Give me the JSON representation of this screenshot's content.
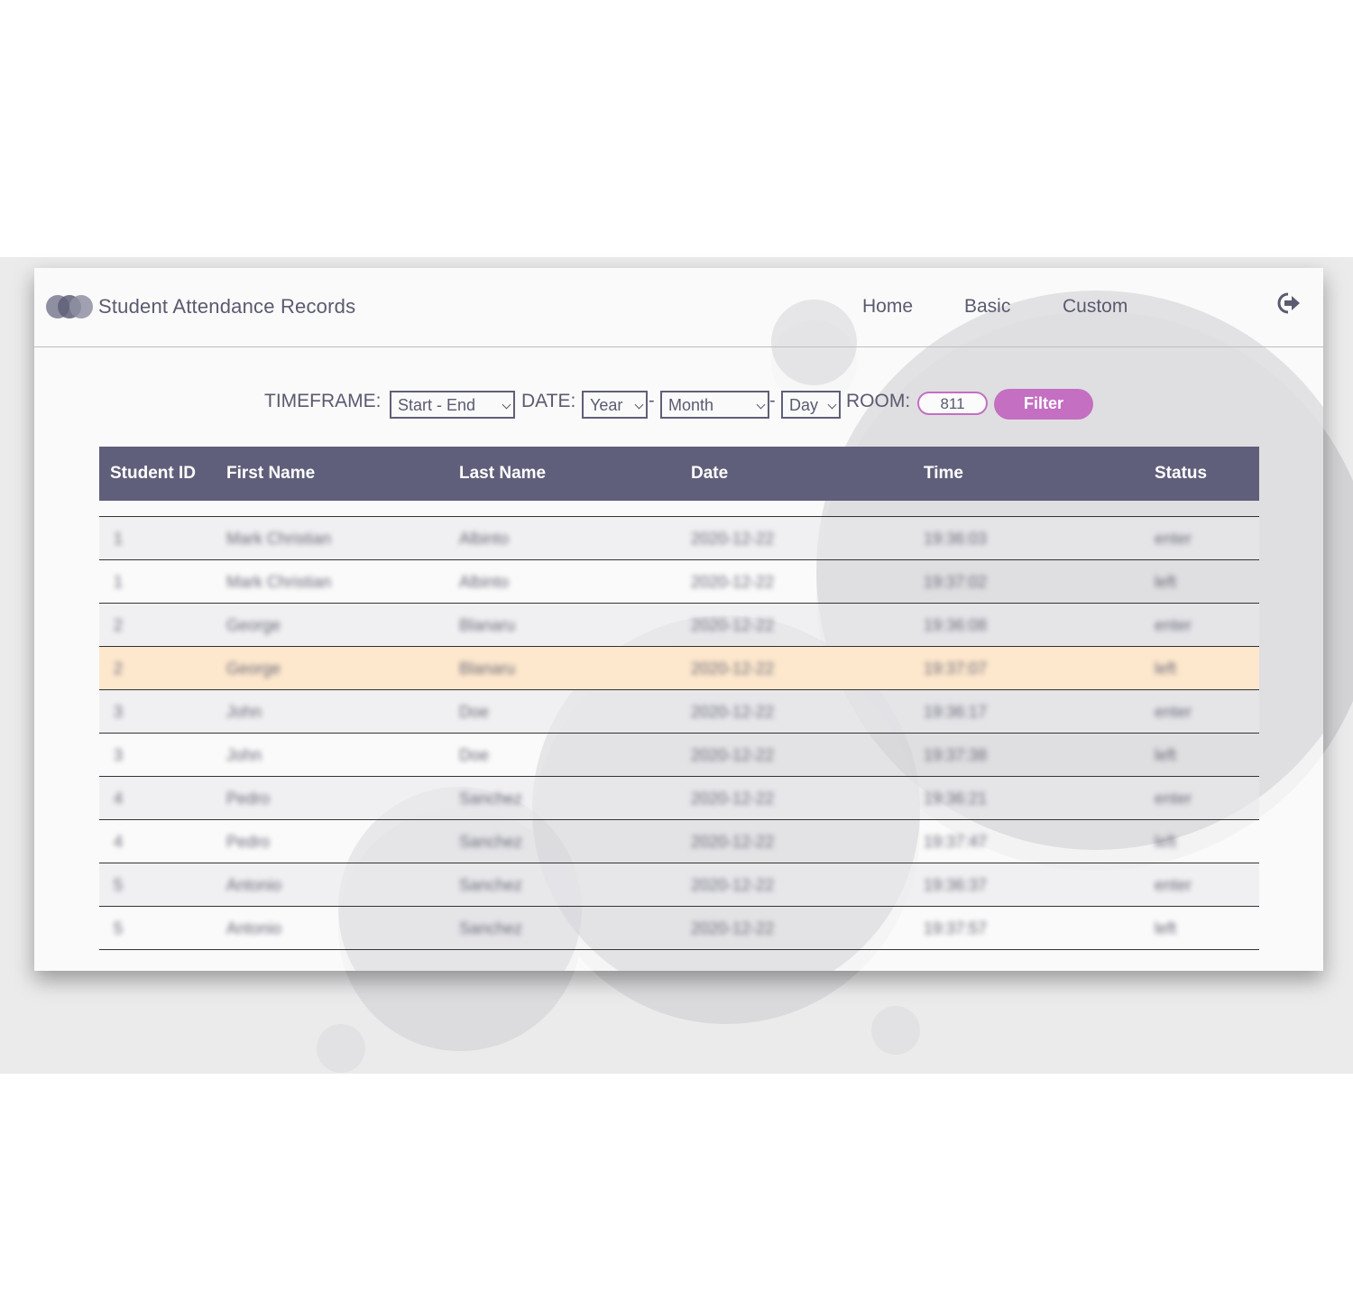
{
  "app": {
    "title": "Student Attendance Records"
  },
  "nav": {
    "links": [
      "Home",
      "Basic",
      "Custom"
    ]
  },
  "filters": {
    "timeframe_label": "TIMEFRAME:",
    "timeframe_value": "Start - End",
    "date_label": "DATE:",
    "year_value": "Year",
    "month_value": "Month",
    "day_value": "Day",
    "separator": "-",
    "room_label": "ROOM:",
    "room_value": "811",
    "filter_button": "Filter"
  },
  "table": {
    "headers": [
      "Student ID",
      "First Name",
      "Last Name",
      "Date",
      "Time",
      "Status"
    ],
    "rows": [
      [
        "1",
        "Mark Christian",
        "Albinto",
        "2020-12-22",
        "19:36:03",
        "enter"
      ],
      [
        "1",
        "Mark Christian",
        "Albinto",
        "2020-12-22",
        "19:37:02",
        "left"
      ],
      [
        "2",
        "George",
        "Blanaru",
        "2020-12-22",
        "19:36:08",
        "enter"
      ],
      [
        "2",
        "George",
        "Blanaru",
        "2020-12-22",
        "19:37:07",
        "left"
      ],
      [
        "3",
        "John",
        "Doe",
        "2020-12-22",
        "19:36:17",
        "enter"
      ],
      [
        "3",
        "John",
        "Doe",
        "2020-12-22",
        "19:37:38",
        "left"
      ],
      [
        "4",
        "Pedro",
        "Sanchez",
        "2020-12-22",
        "19:36:21",
        "enter"
      ],
      [
        "4",
        "Pedro",
        "Sanchez",
        "2020-12-22",
        "19:37:47",
        "left"
      ],
      [
        "5",
        "Antonio",
        "Sanchez",
        "2020-12-22",
        "19:36:37",
        "enter"
      ],
      [
        "5",
        "Antonio",
        "Sanchez",
        "2020-12-22",
        "19:37:57",
        "left"
      ]
    ],
    "highlighted_row": 3
  },
  "colors": {
    "accent": "#c46fc2",
    "header_bg": "#5f5f7b",
    "highlight_row": "#fde7cd",
    "text": "#5a5a70"
  },
  "icons": {
    "logo": "three-circles-logo",
    "logout": "logout-icon"
  }
}
